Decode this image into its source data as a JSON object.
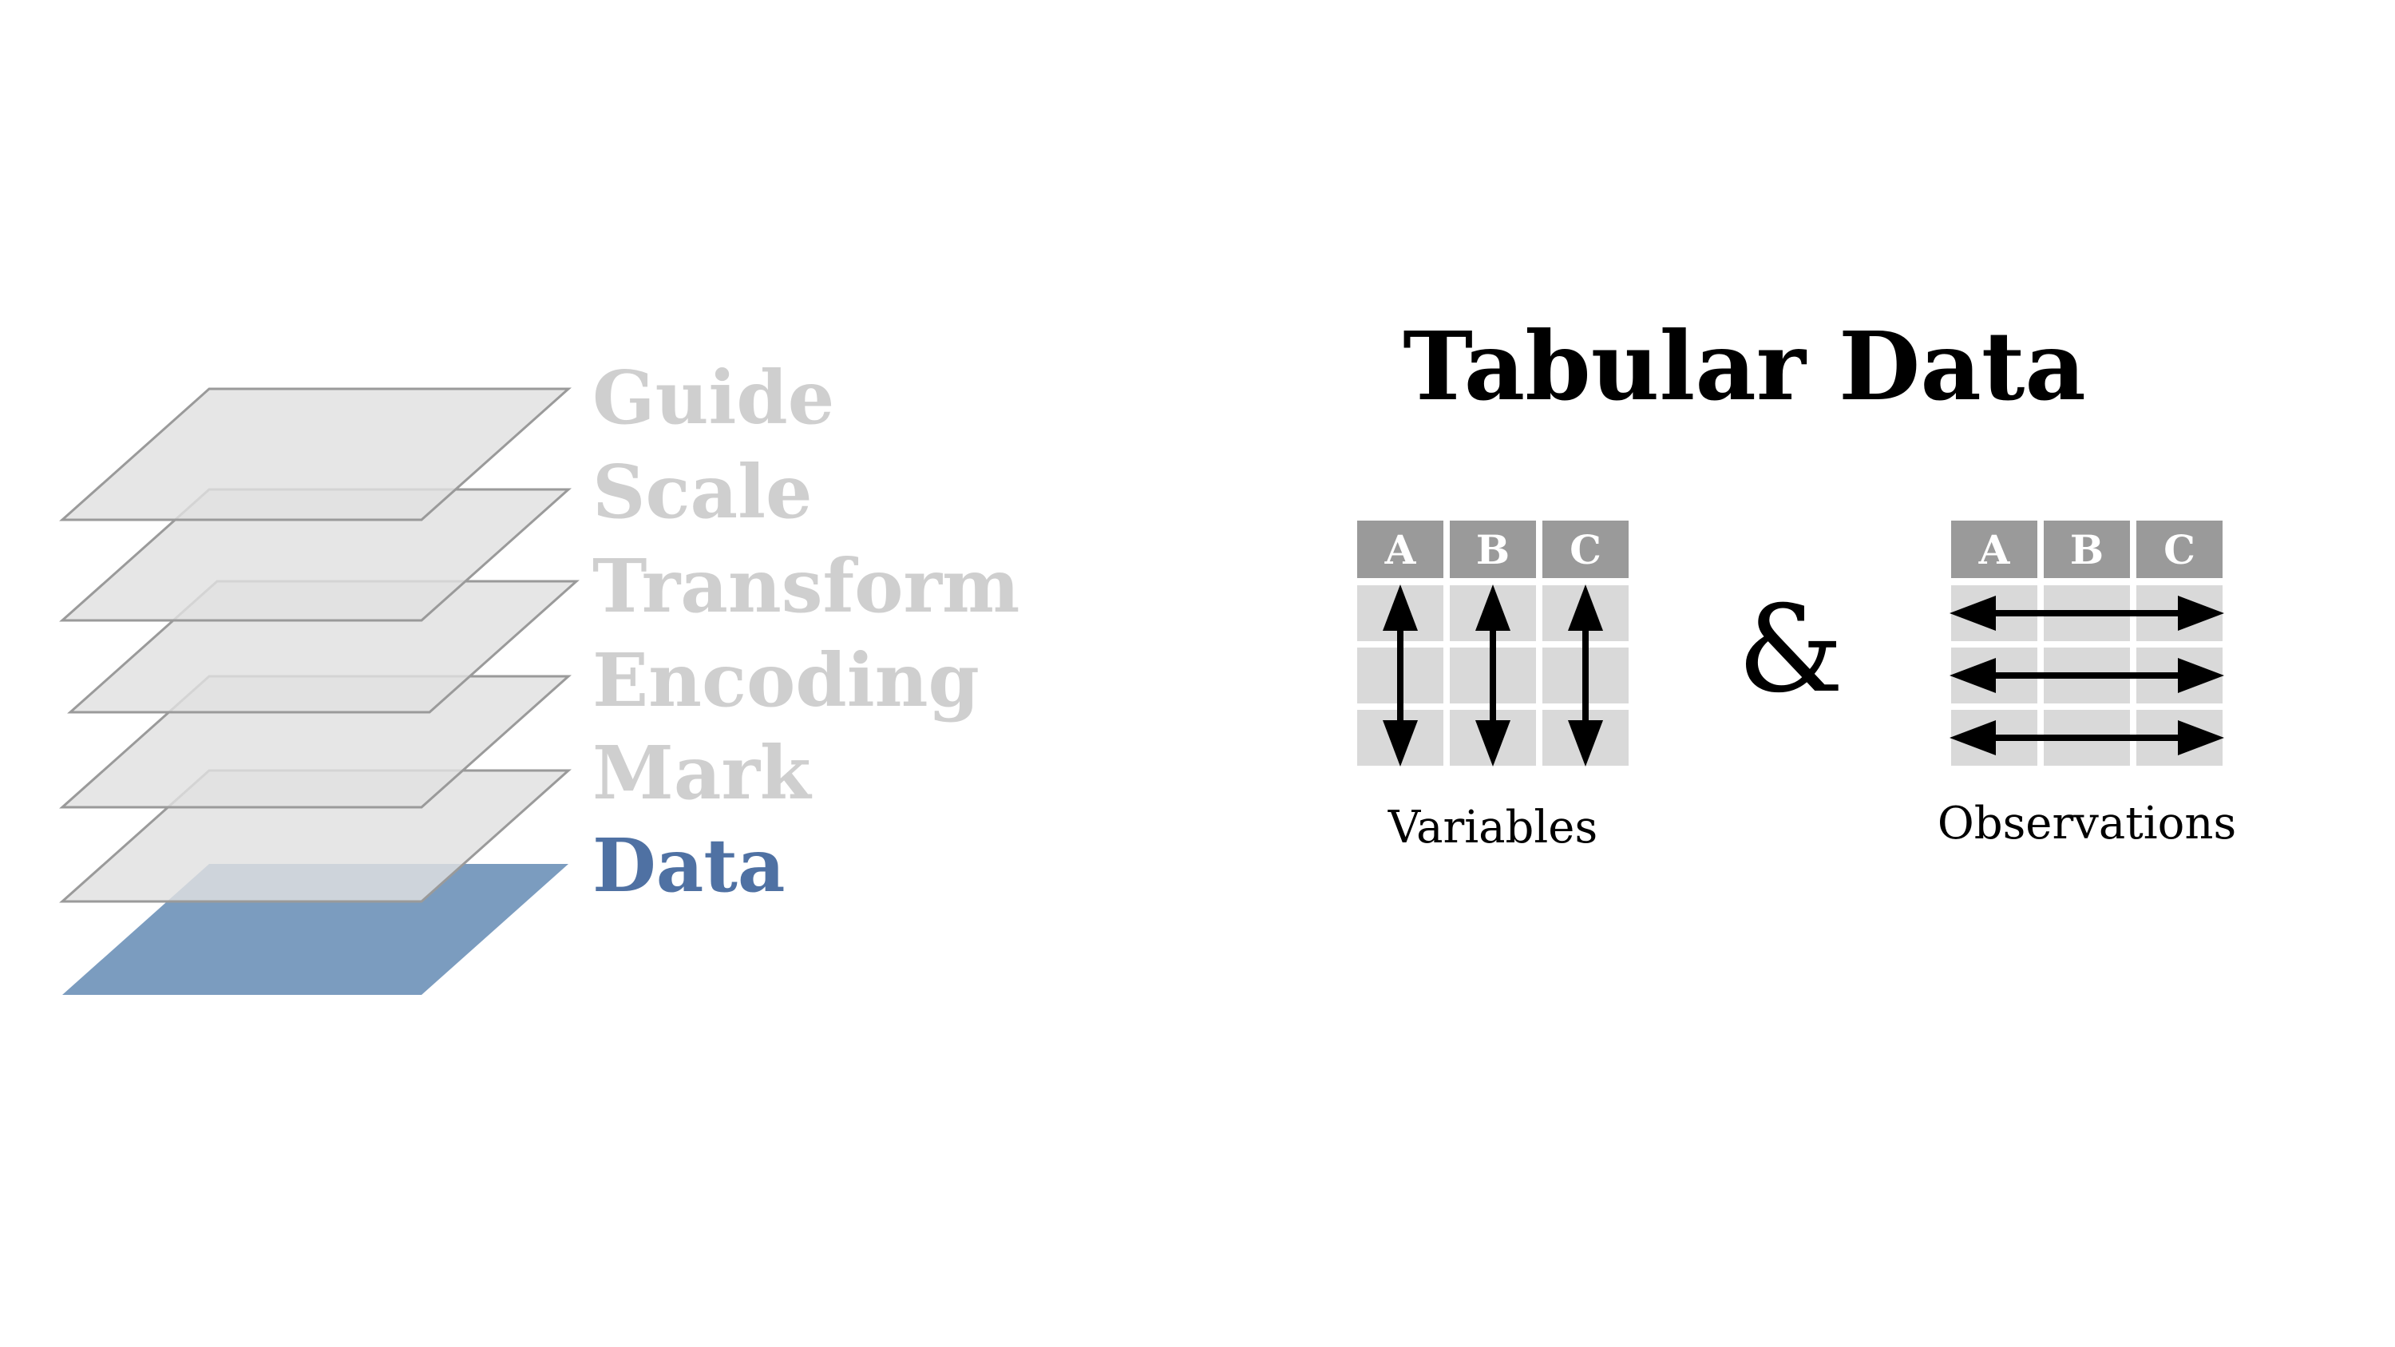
{
  "layers": [
    {
      "label": "Guide",
      "active": false
    },
    {
      "label": "Scale",
      "active": false
    },
    {
      "label": "Transform",
      "active": false
    },
    {
      "label": "Encoding",
      "active": false
    },
    {
      "label": "Mark",
      "active": false
    },
    {
      "label": "Data",
      "active": true
    }
  ],
  "colors": {
    "inactive_fill": "#e0e0e0",
    "inactive_stroke": "#9a9a9a",
    "inactive_label": "#cfcfcf",
    "active_fill": "#7b9cbf",
    "active_label": "#4f71a3",
    "header_fill": "#9a9a9a",
    "cell_fill": "#d9d9d9",
    "arrow": "#000000",
    "text": "#000000"
  },
  "title": "Tabular Data",
  "ampersand": "&",
  "variables_table": {
    "headers": [
      "A",
      "B",
      "C"
    ],
    "caption": "Variables"
  },
  "observations_table": {
    "headers": [
      "A",
      "B",
      "C"
    ],
    "caption": "Observations"
  }
}
